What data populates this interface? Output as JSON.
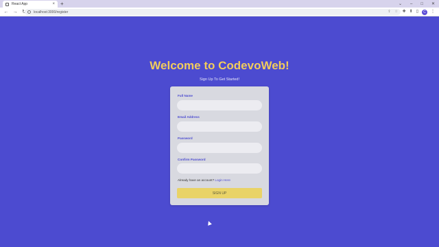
{
  "browser": {
    "tab_title": "React App",
    "tab_close": "×",
    "new_tab": "+",
    "url": "localhost:3000/register",
    "window_controls": [
      "⌄",
      "–",
      "□",
      "✕"
    ],
    "nav": {
      "back": "←",
      "forward": "→",
      "reload": "↻"
    },
    "profile_initial": "C"
  },
  "page": {
    "heading": "Welcome to CodevoWeb!",
    "subheading": "Sign Up To Get Started!"
  },
  "form": {
    "fields": [
      {
        "label": "Full Name",
        "value": ""
      },
      {
        "label": "Email Address",
        "value": ""
      },
      {
        "label": "Password",
        "value": ""
      },
      {
        "label": "Confirm Password",
        "value": ""
      }
    ],
    "login_prompt": "Already have an account?",
    "login_link": "Login Here",
    "submit_label": "SIGN UP"
  },
  "colors": {
    "background": "#4c4bd0",
    "heading": "#f2cc5c",
    "card": "#d8d9e0",
    "button": "#e9d367"
  }
}
